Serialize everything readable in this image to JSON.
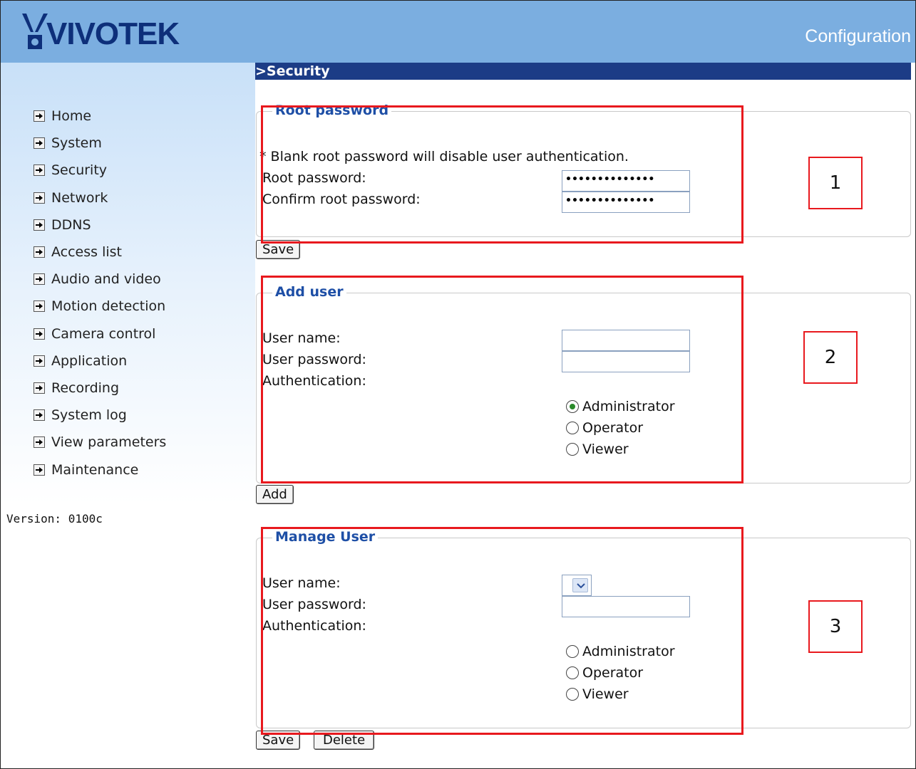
{
  "header": {
    "logo_text": "VIVOTEK",
    "config_label": "Configuration"
  },
  "sidebar": {
    "items": [
      {
        "label": "Home"
      },
      {
        "label": "System"
      },
      {
        "label": "Security"
      },
      {
        "label": "Network"
      },
      {
        "label": "DDNS"
      },
      {
        "label": "Access list"
      },
      {
        "label": "Audio and video"
      },
      {
        "label": "Motion detection"
      },
      {
        "label": "Camera control"
      },
      {
        "label": "Application"
      },
      {
        "label": "Recording"
      },
      {
        "label": "System log"
      },
      {
        "label": "View parameters"
      },
      {
        "label": "Maintenance"
      }
    ],
    "version": "Version: 0100c"
  },
  "page_title": ">Security",
  "root_password": {
    "legend": "Root password",
    "note": "* Blank root password will disable user authentication.",
    "password_label": "Root password:",
    "confirm_label": "Confirm root password:",
    "password_value": "••••••••••••••",
    "confirm_value": "••••••••••••••",
    "save_label": "Save"
  },
  "add_user": {
    "legend": "Add user",
    "username_label": "User name:",
    "password_label": "User password:",
    "auth_label": "Authentication:",
    "options": [
      "Administrator",
      "Operator",
      "Viewer"
    ],
    "selected": "Administrator",
    "add_label": "Add"
  },
  "manage_user": {
    "legend": "Manage User",
    "username_label": "User name:",
    "password_label": "User password:",
    "auth_label": "Authentication:",
    "options": [
      "Administrator",
      "Operator",
      "Viewer"
    ],
    "save_label": "Save",
    "delete_label": "Delete"
  },
  "annotations": {
    "box1": "1",
    "box2": "2",
    "box3": "3"
  },
  "colors": {
    "header_bg": "#7baee0",
    "title_bar": "#1c3c86",
    "legend_text": "#1e4fa6",
    "annotation_red": "#e8191e"
  }
}
